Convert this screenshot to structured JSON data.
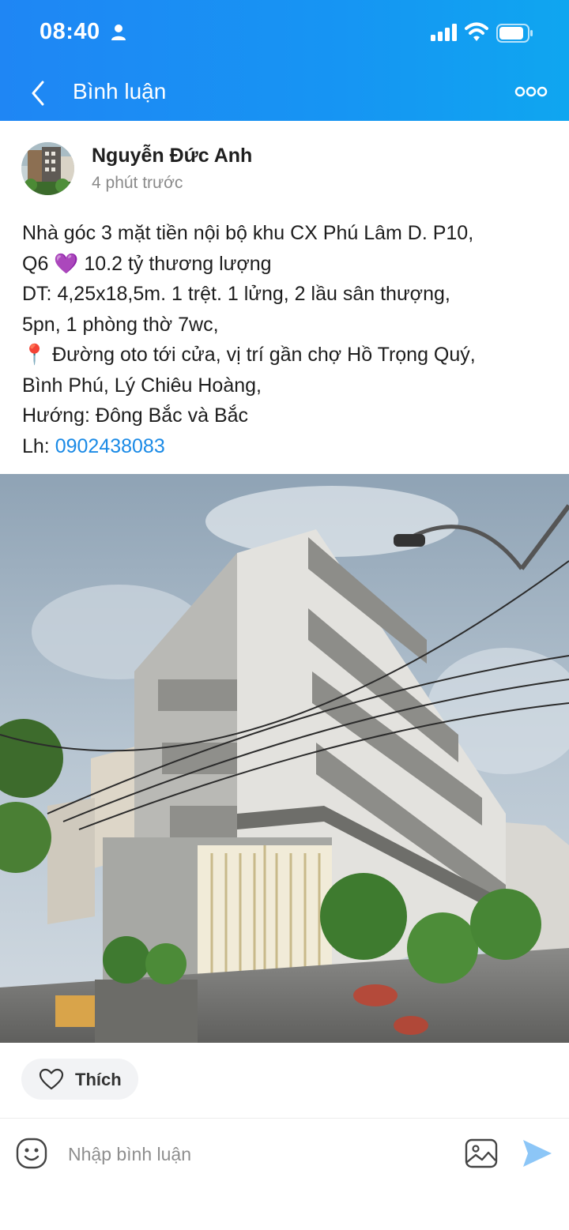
{
  "status_bar": {
    "time": "08:40"
  },
  "header": {
    "title": "Bình luận"
  },
  "post": {
    "author": "Nguyễn Đức Anh",
    "time": "4 phút trước",
    "lines": [
      "Nhà góc 3 mặt tiền nội bộ khu CX Phú Lâm D. P10,",
      "Q6 💜 10.2 tỷ thương lượng",
      "DT: 4,25x18,5m. 1 trệt. 1 lửng, 2 lầu sân thượng,",
      "5pn, 1 phòng thờ 7wc,",
      "📍 Đường oto tới cửa, vị trí gần chợ Hồ Trọng Quý,",
      "Bình Phú, Lý Chiêu Hoàng,",
      "Hướng: Đông Bắc và Bắc"
    ],
    "contact_prefix": "Lh: ",
    "phone": "0902438083"
  },
  "actions": {
    "like_label": "Thích"
  },
  "composer": {
    "placeholder": "Nhập bình luận"
  },
  "colors": {
    "header": "#1f86f4",
    "link": "#1a8ae6",
    "send": "#8cc6f7"
  }
}
